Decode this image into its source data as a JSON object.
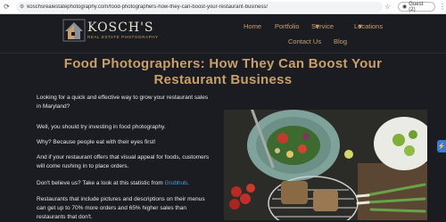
{
  "browser": {
    "url": "koschsrealestatephotography.com/food-photographers-how-they-can-boost-your-restaurant-business/",
    "profile_label": "Guest (2)"
  },
  "site": {
    "logo_name": "KOSCH'S",
    "logo_sub": "REAL ESTATE PHOTOGRAPHY",
    "nav": {
      "home": "Home",
      "portfolio": "Portfolio",
      "service": "Service",
      "locations": "Locations",
      "contact": "Contact Us",
      "blog": "Blog"
    }
  },
  "article": {
    "title_line1": "Food Photographers: How They Can Boost Your",
    "title_line2": "Restaurant Business",
    "p1_line1": "Looking for a quick and effective way to grow your restaurant sales",
    "p1_line2": "in Maryland?",
    "p2": "Well, you should try investing in food photography.",
    "p3": "Why? Because people eat with their eyes first!",
    "p4_line1": "And if your restaurant offers that visual appeal for foods, customers",
    "p4_line2": "will come rushing in to place orders.",
    "p5_prefix": "Don't believe us? Take a look at this statistic from",
    "p5_link": "Grubhub",
    "p5_suffix": ".",
    "p6_line1": "Restaurants that include pictures and descriptions on their menus",
    "p6_line2": "can get up to 70% more orders and 65% higher sales than",
    "p6_line3": "restaurants that don't."
  },
  "colors": {
    "background": "#1a1c21",
    "accent": "#c9a06a",
    "link": "#3ea3e6"
  }
}
